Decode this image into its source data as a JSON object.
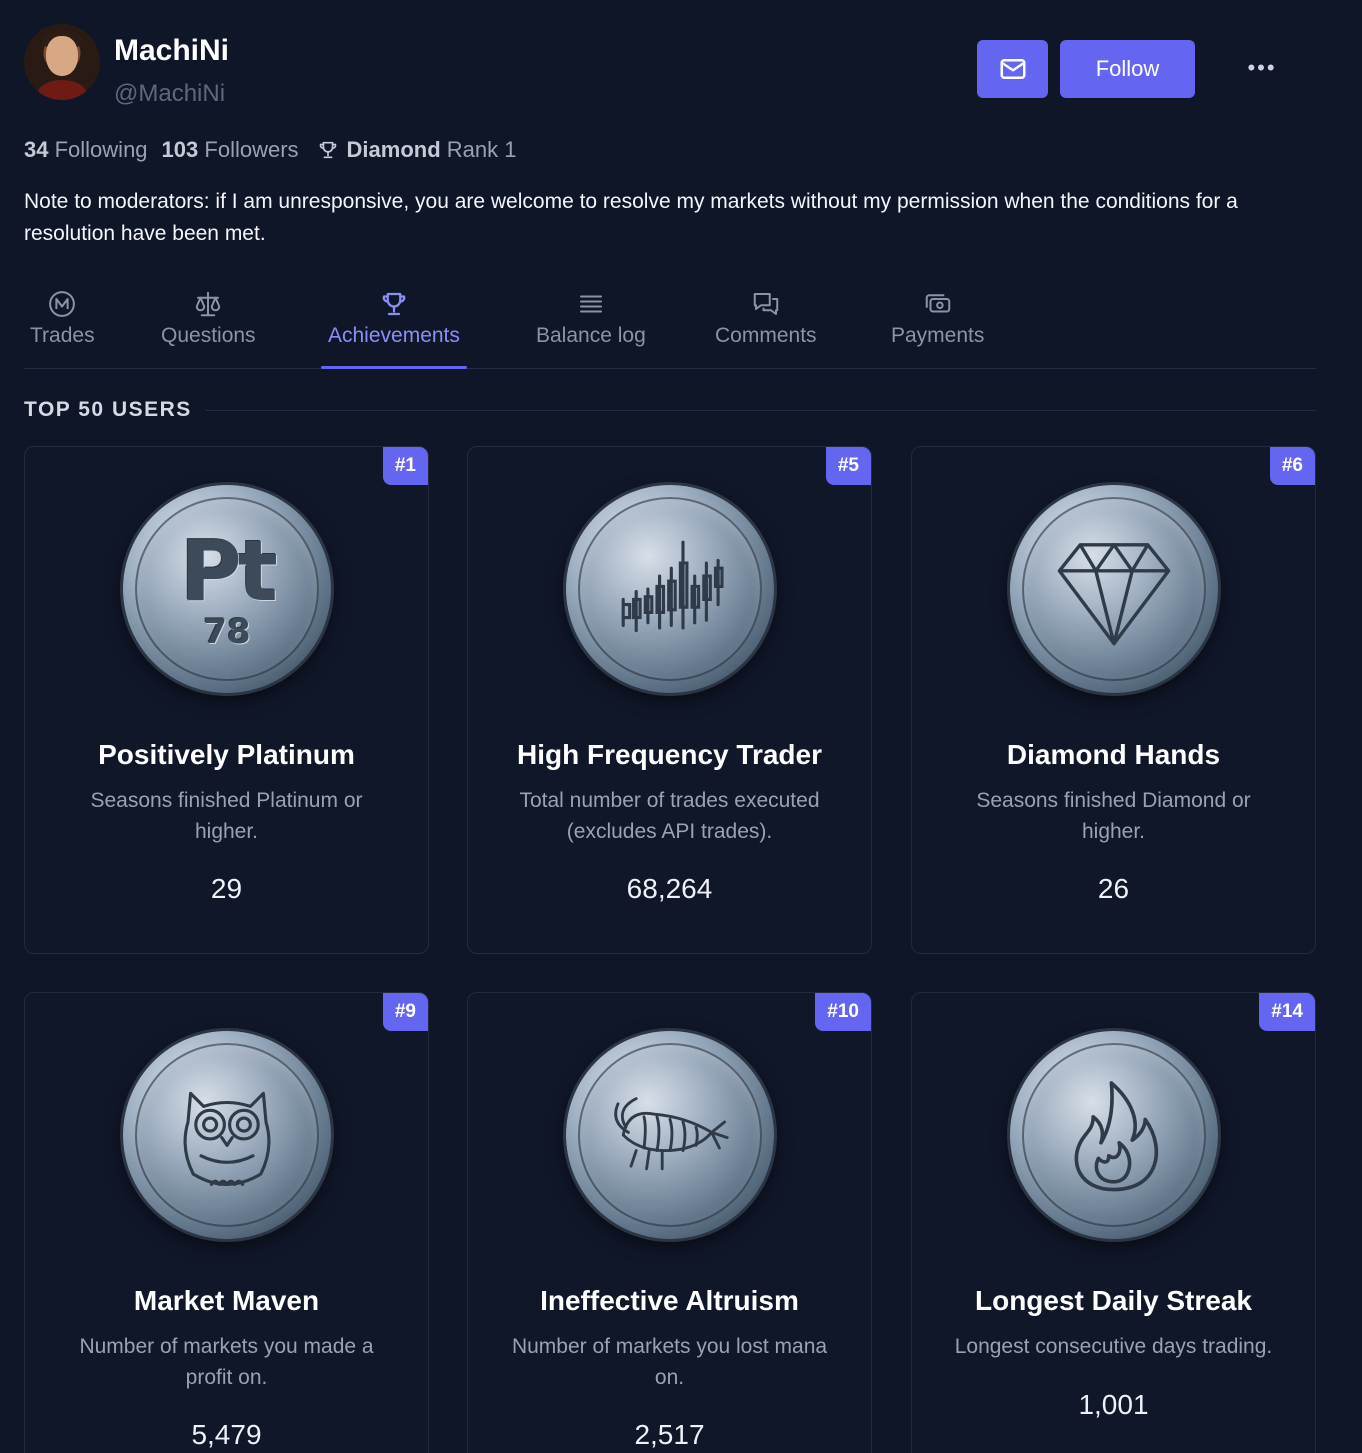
{
  "profile": {
    "name": "MachiNi",
    "handle": "@MachiNi",
    "following_count": "34",
    "following_label": "Following",
    "followers_count": "103",
    "followers_label": "Followers",
    "rank_tier": "Diamond",
    "rank_label": "Rank 1",
    "bio": "Note to moderators: if I am unresponsive, you are welcome to resolve my markets without my permission when the conditions for a resolution have been met."
  },
  "actions": {
    "follow_label": "Follow",
    "more_label": "•••"
  },
  "tabs": [
    {
      "label": "Trades",
      "icon": "mana-coin-icon"
    },
    {
      "label": "Questions",
      "icon": "scale-icon"
    },
    {
      "label": "Achievements",
      "icon": "trophy-icon",
      "active": true
    },
    {
      "label": "Balance log",
      "icon": "list-icon"
    },
    {
      "label": "Comments",
      "icon": "chat-bubbles-icon"
    },
    {
      "label": "Payments",
      "icon": "cash-icon"
    }
  ],
  "section": {
    "title": "TOP 50 USERS"
  },
  "achievements": [
    {
      "rank": "#1",
      "title": "Positively Platinum",
      "description": "Seasons finished Platinum or higher.",
      "value": "29",
      "medal": "platinum-element-icon",
      "medal_symbol": "Pt",
      "medal_number": "78"
    },
    {
      "rank": "#5",
      "title": "High Frequency Trader",
      "description": "Total number of trades executed (excludes API trades).",
      "value": "68,264",
      "medal": "candlestick-chart-icon"
    },
    {
      "rank": "#6",
      "title": "Diamond Hands",
      "description": "Seasons finished Diamond or higher.",
      "value": "26",
      "medal": "diamond-icon"
    },
    {
      "rank": "#9",
      "title": "Market Maven",
      "description": "Number of markets you made a profit on.",
      "value": "5,479",
      "medal": "owl-icon"
    },
    {
      "rank": "#10",
      "title": "Ineffective Altruism",
      "description": "Number of markets you lost mana on.",
      "value": "2,517",
      "medal": "shrimp-icon"
    },
    {
      "rank": "#14",
      "title": "Longest Daily Streak",
      "description": "Longest consecutive days trading.",
      "value": "1,001",
      "medal": "flame-icon"
    }
  ],
  "colors": {
    "background": "#0f1628",
    "accent": "#6466f1",
    "active_tab": "#8b8ef7",
    "muted_text": "#9aa1b3"
  }
}
